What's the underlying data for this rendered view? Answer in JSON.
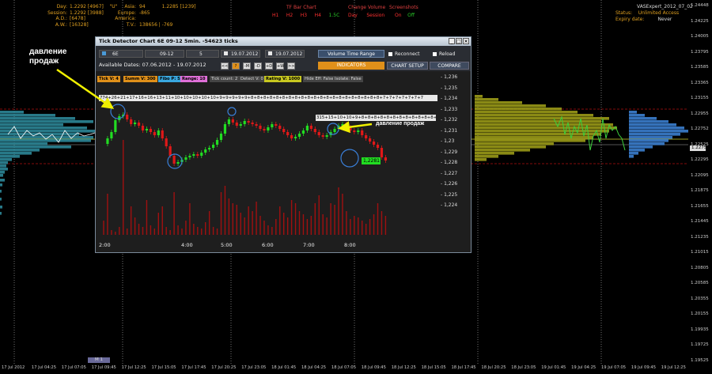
{
  "top_info": {
    "day": "Day:",
    "day_val": "1.2292 [4967]",
    "day_tag": "\"U\"",
    "session": "Session:",
    "session_val": "1.2292 [3988]",
    "ad": "A.D.:",
    "ad_val": "[6478]",
    "aw": "A.W.:",
    "aw_val": "[16328]",
    "asia": "Asia:",
    "asia_val1": "94",
    "asia_val2": "1.2285 [1239]",
    "europe": "Europe:",
    "europe_val": "-865",
    "america": "America:",
    "tv": "T.V.:",
    "tv_val": "138656 | -769"
  },
  "menu": {
    "tf_bar_chart": "TF Bar Chart",
    "tf_items": [
      "H1",
      "H2",
      "H3",
      "H4",
      "1.5C"
    ],
    "change_volume": "Change Volume",
    "cv_items": [
      "Day",
      "Session"
    ],
    "screenshots": "Screenshots",
    "sc_items": [
      "On",
      "Off"
    ]
  },
  "top_right": {
    "title": "VASExpert_2012_07_02",
    "status": "Status:",
    "status_val": "Unlimited Access",
    "expiry": "Expiry date:",
    "expiry_val": "Never"
  },
  "price_axis": [
    "1.24448",
    "1.24225",
    "1.24005",
    "1.23795",
    "1.23585",
    "1.23365",
    "1.23155",
    "1.22955",
    "1.22752",
    "1.22525",
    "1.22295",
    "1.22095",
    "1.21875",
    "1.21655",
    "1.21445",
    "1.21235",
    "1.21015",
    "1.20805",
    "1.20585",
    "1.20355",
    "1.20155",
    "1.19935",
    "1.19725",
    "1.19525"
  ],
  "current_price_badge": "1.22752",
  "time_axis": [
    "17 Jul 2012",
    "17 Jul 04:25",
    "17 Jul 07:05",
    "17 Jul 09:45",
    "17 Jul 12:25",
    "17 Jul 15:05",
    "17 Jul 17:45",
    "17 Jul 20:25",
    "17 Jul 23:05",
    "18 Jul 01:45",
    "18 Jul 04:25",
    "18 Jul 07:05",
    "18 Jul 09:45",
    "18 Jul 12:25",
    "18 Jul 15:05",
    "18 Jul 17:45",
    "18 Jul 20:25",
    "18 Jul 23:05",
    "19 Jul 01:45",
    "19 Jul 04:25",
    "19 Jul 07:05",
    "19 Jul 09:45",
    "19 Jul 12:25"
  ],
  "bottom_tab": "M 1",
  "annotations": {
    "left": "давление\nпродаж",
    "right": "давление продаж"
  },
  "dialog": {
    "title": "Tick Detector Chart 6E 09-12  5min.  -54623 ticks",
    "symbol": "6E",
    "contract": "09-12",
    "interval": "5",
    "date_from": "19.07.2012",
    "date_to": "19.07.2012",
    "volume_time_range": "Volume Time Range",
    "reconnect": "Reconnect",
    "reload": "Reload",
    "available_dates": "Available Dates: 07.06.2012 - 19.07.2012",
    "indicators": "INDICATORS",
    "chart_setup": "CHART SETUP",
    "compare": "COMPARE",
    "mini_buttons": [
      "<<",
      "?",
      "-M",
      "-D",
      "+D",
      "+W",
      ">>"
    ],
    "stats": {
      "tick_v": "Tick V: 4",
      "summ_v": "Summ V: 300",
      "fibo_p": "Fibo P: 5",
      "range": "Range: 10",
      "tick_count": "Tick count: 2",
      "detect_v": "Detect V: 0",
      "rating_v": "Rating V: 1000",
      "hide_eff": "Hide Eff: False",
      "isolate": "Isolate: False"
    },
    "tick_seq_1": "774+26+21+17+16+16+13+11+10+10+10+10+10+9+9+9+9+9+8+8+8+8+8+8+8+8+8+8+8+8+8+8+8+8+8+8+8+8+8+7+7+7+7+7+7+7",
    "tick_seq_2": "315+15+10+10+9+8+8+8+8+8+8+8+8+8+8+8+8+8",
    "price_labels": [
      "1,236",
      "1,235",
      "1,234",
      "1,233",
      "1,232",
      "1,231",
      "1,23",
      "1,229",
      "1,228",
      "1,227",
      "1,226",
      "1,225",
      "1,224"
    ],
    "last_price": "1,2281",
    "time_labels": [
      "2:00",
      "4:00",
      "5:00",
      "6:00",
      "7:00",
      "8:00"
    ]
  },
  "colors": {
    "up_candle": "#22dd22",
    "down_candle": "#e01818",
    "volume_bar": "#a01010",
    "profile_teal": "#2f8fa0",
    "profile_olive": "#9a9a18",
    "profile_blue": "#3b7fcf",
    "accent_orange": "#e0901a"
  }
}
